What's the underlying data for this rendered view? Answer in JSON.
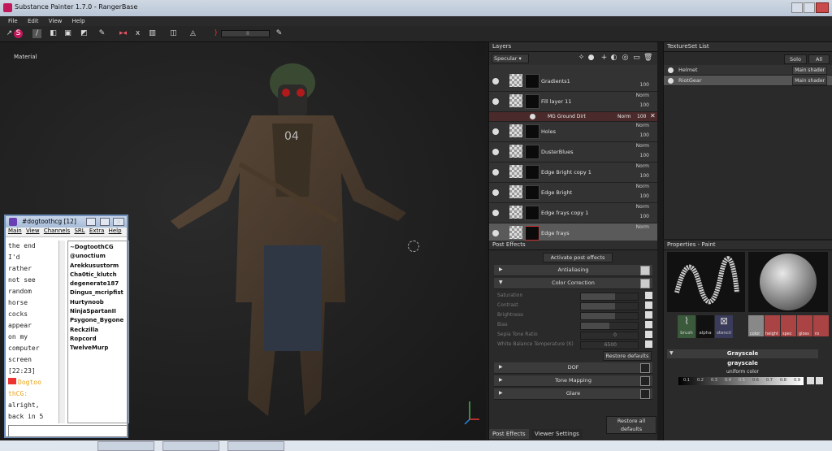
{
  "window": {
    "title": "Substance Painter 1.7.0 - RangerBase"
  },
  "menu": [
    "File",
    "Edit",
    "View",
    "Help"
  ],
  "toolbar": {
    "size_value": "8"
  },
  "viewport": {
    "label": "Material"
  },
  "layers": {
    "title": "Layers",
    "channel": "Specular",
    "rows": [
      {
        "name": "Gradients1",
        "blend": "",
        "opacity": "100"
      },
      {
        "name": "Fill layer 11",
        "blend": "Norm",
        "opacity": "100"
      },
      {
        "name": "Holes",
        "blend": "Norm",
        "opacity": "100"
      },
      {
        "name": "DusterBlues",
        "blend": "Norm",
        "opacity": "100"
      },
      {
        "name": "Edge Bright copy 1",
        "blend": "Norm",
        "opacity": "100"
      },
      {
        "name": "Edge Bright",
        "blend": "Norm",
        "opacity": "100"
      },
      {
        "name": "Edge frays copy 1",
        "blend": "Norm",
        "opacity": "100"
      },
      {
        "name": "Edge frays",
        "blend": "Norm",
        "opacity": ""
      }
    ],
    "effect": {
      "name": "MG Ground Dirt",
      "blend": "Norm",
      "opacity": "100"
    }
  },
  "textureset": {
    "title": "TextureSet List",
    "solo_label": "Solo",
    "all_label": "All",
    "rows": [
      {
        "name": "Helmet",
        "shader": "Main shader"
      },
      {
        "name": "RiotGear",
        "shader": "Main shader"
      }
    ]
  },
  "post_effects": {
    "title": "Post Effects",
    "activate_label": "Activate post effects",
    "antialiasing": "Antialiasing",
    "color_correction": "Color Correction",
    "props": [
      {
        "label": "Saturation",
        "value": ""
      },
      {
        "label": "Contrast",
        "value": ""
      },
      {
        "label": "Brightness",
        "value": ""
      },
      {
        "label": "Bias",
        "value": ""
      },
      {
        "label": "Sepia Tone Ratio",
        "value": "0"
      },
      {
        "label": "White Balance Temperature (K)",
        "value": "6500"
      }
    ],
    "restore_defaults": "Restore defaults",
    "dof": "DOF",
    "tone_mapping": "Tone Mapping",
    "glare": "Glare",
    "restore_all": "Restore all defaults",
    "tabs": [
      "Post Effects",
      "Viewer Settings"
    ]
  },
  "properties": {
    "title": "Properties - Paint",
    "brush_slots": [
      "brush",
      "alpha",
      "stencil"
    ],
    "material_slots": [
      "color",
      "height",
      "spec",
      "gloss",
      "ro"
    ],
    "section": "Grayscale",
    "grayscale_label": "grayscale",
    "uniform_label": "uniform color",
    "ticks": [
      "0.1",
      "0.2",
      "0.3",
      "0.4",
      "0.5",
      "0.6",
      "0.7",
      "0.8",
      "0.9"
    ]
  },
  "chat": {
    "title": "#dogtoothcg [12]",
    "menu": [
      "Main",
      "View",
      "Channels",
      "SRL",
      "Extra",
      "Help"
    ],
    "log": [
      "the end",
      "I'd",
      "rather",
      "not see",
      "random",
      "horse",
      "cocks",
      "appear",
      "on my",
      "computer",
      "screen",
      "[22:23]",
      "Dogtoo",
      "thCG:",
      "alright,",
      "back in 5"
    ],
    "users": [
      "~DogtoothCG",
      "@unoctium",
      "Arekkusustorm",
      "Cha0tic_klutch",
      "degenerate187",
      "Dingus_mcripfist",
      "Hurtynoob",
      "NinjaSpartanII",
      "Psygone_Bygone",
      "Reckzilla",
      "Ropcord",
      "TwelveMurp"
    ]
  }
}
